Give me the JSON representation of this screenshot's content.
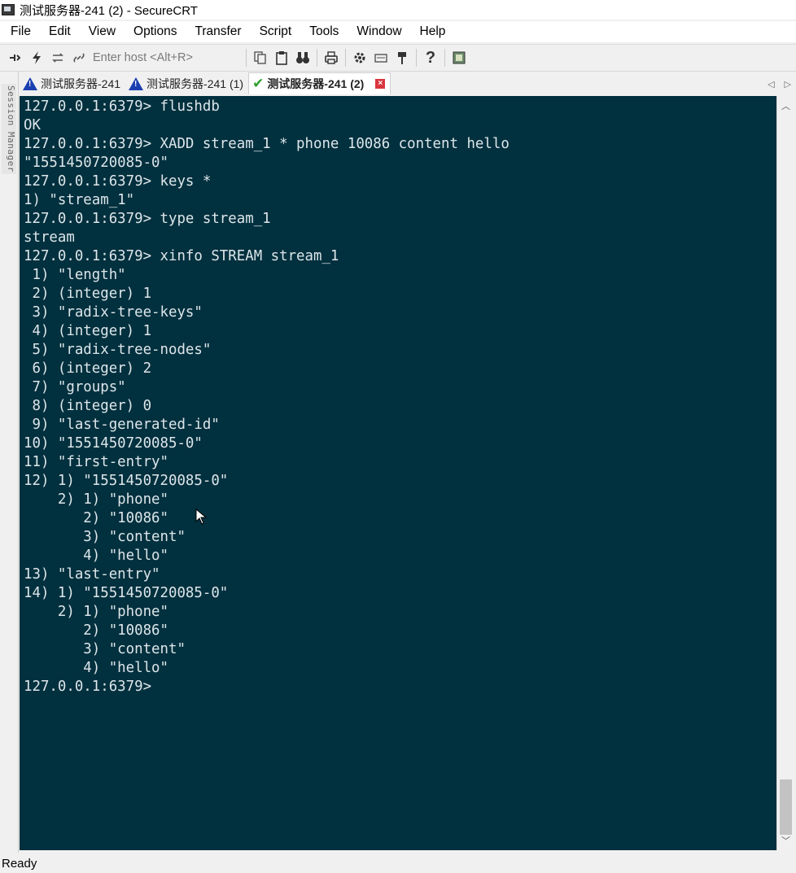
{
  "window": {
    "title": "测试服务器-241 (2) - SecureCRT"
  },
  "menu": [
    "File",
    "Edit",
    "View",
    "Options",
    "Transfer",
    "Script",
    "Tools",
    "Window",
    "Help"
  ],
  "toolbar": {
    "host_placeholder": "Enter host <Alt+R>"
  },
  "tabs": [
    {
      "label": "测试服务器-241",
      "status": "warning-icon",
      "active": false
    },
    {
      "label": "测试服务器-241 (1)",
      "status": "warning-icon",
      "active": false
    },
    {
      "label": "测试服务器-241 (2)",
      "status": "check-icon",
      "active": true
    }
  ],
  "sidebar": {
    "session_manager_label": "Session Manager"
  },
  "terminal": {
    "lines": [
      "127.0.0.1:6379> flushdb",
      "OK",
      "127.0.0.1:6379> XADD stream_1 * phone 10086 content hello",
      "\"1551450720085-0\"",
      "127.0.0.1:6379> keys *",
      "1) \"stream_1\"",
      "127.0.0.1:6379> type stream_1",
      "stream",
      "127.0.0.1:6379> xinfo STREAM stream_1",
      " 1) \"length\"",
      " 2) (integer) 1",
      " 3) \"radix-tree-keys\"",
      " 4) (integer) 1",
      " 5) \"radix-tree-nodes\"",
      " 6) (integer) 2",
      " 7) \"groups\"",
      " 8) (integer) 0",
      " 9) \"last-generated-id\"",
      "10) \"1551450720085-0\"",
      "11) \"first-entry\"",
      "12) 1) \"1551450720085-0\"",
      "    2) 1) \"phone\"",
      "       2) \"10086\"",
      "       3) \"content\"",
      "       4) \"hello\"",
      "13) \"last-entry\"",
      "14) 1) \"1551450720085-0\"",
      "    2) 1) \"phone\"",
      "       2) \"10086\"",
      "       3) \"content\"",
      "       4) \"hello\"",
      "127.0.0.1:6379> "
    ],
    "bg_color": "#01303e",
    "fg_color": "#dde6ea"
  },
  "status": {
    "text": "Ready"
  }
}
